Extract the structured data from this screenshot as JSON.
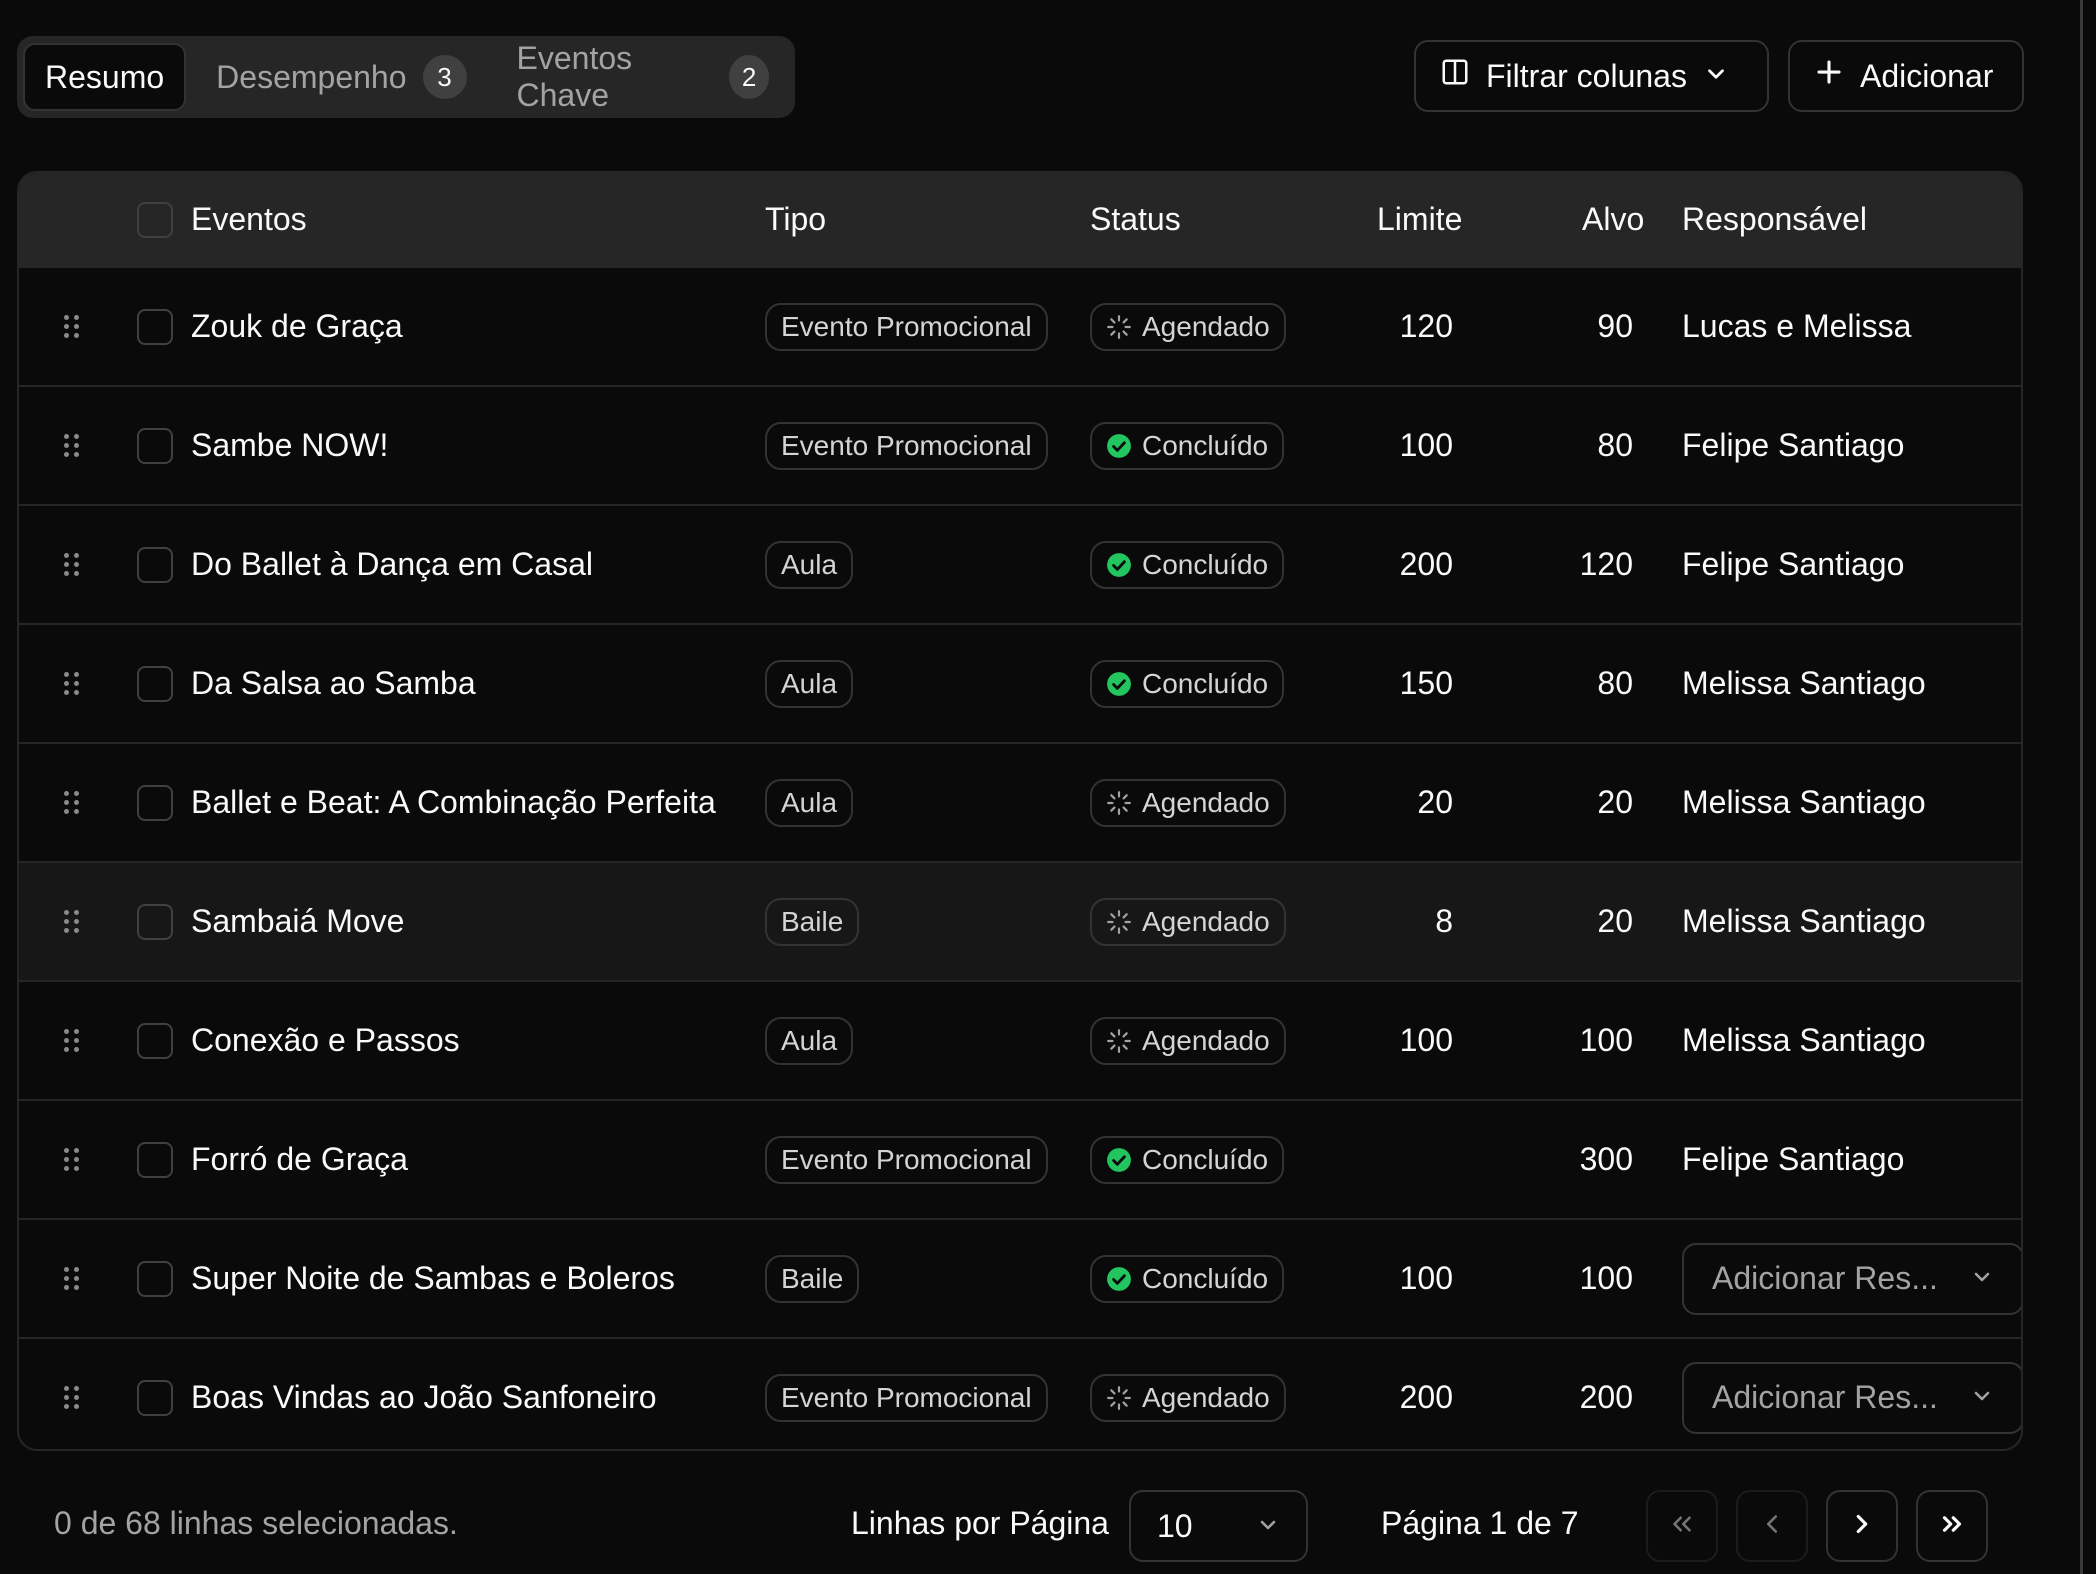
{
  "tabs": [
    {
      "label": "Resumo",
      "badge": null,
      "active": true
    },
    {
      "label": "Desempenho",
      "badge": "3",
      "active": false
    },
    {
      "label": "Eventos Chave",
      "badge": "2",
      "active": false
    }
  ],
  "toolbar": {
    "filter_label": "Filtrar colunas",
    "add_label": "Adicionar"
  },
  "table": {
    "headers": {
      "name": "Eventos",
      "type": "Tipo",
      "status": "Status",
      "limit": "Limite",
      "target": "Alvo",
      "owner": "Responsável"
    },
    "rows": [
      {
        "name": "Zouk de Graça",
        "type": "Evento Promocional",
        "status": "Agendado",
        "limit": "120",
        "target": "90",
        "owner": "Lucas e Melissa"
      },
      {
        "name": "Sambe NOW!",
        "type": "Evento Promocional",
        "status": "Concluído",
        "limit": "100",
        "target": "80",
        "owner": "Felipe Santiago"
      },
      {
        "name": "Do Ballet à Dança em Casal",
        "type": "Aula",
        "status": "Concluído",
        "limit": "200",
        "target": "120",
        "owner": "Felipe Santiago"
      },
      {
        "name": "Da Salsa ao Samba",
        "type": "Aula",
        "status": "Concluído",
        "limit": "150",
        "target": "80",
        "owner": "Melissa Santiago"
      },
      {
        "name": "Ballet e Beat: A Combinação Perfeita",
        "type": "Aula",
        "status": "Agendado",
        "limit": "20",
        "target": "20",
        "owner": "Melissa Santiago"
      },
      {
        "name": "Sambaiá Move",
        "type": "Baile",
        "status": "Agendado",
        "limit": "8",
        "target": "20",
        "owner": "Melissa Santiago"
      },
      {
        "name": "Conexão e Passos",
        "type": "Aula",
        "status": "Agendado",
        "limit": "100",
        "target": "100",
        "owner": "Melissa Santiago"
      },
      {
        "name": "Forró de Graça",
        "type": "Evento Promocional",
        "status": "Concluído",
        "limit": "",
        "target": "300",
        "owner": "Felipe Santiago"
      },
      {
        "name": "Super Noite de Sambas e Boleros",
        "type": "Baile",
        "status": "Concluído",
        "limit": "100",
        "target": "100",
        "owner": ""
      },
      {
        "name": "Boas Vindas ao João Sanfoneiro",
        "type": "Evento Promocional",
        "status": "Agendado",
        "limit": "200",
        "target": "200",
        "owner": ""
      }
    ],
    "owner_placeholder": "Adicionar Res..."
  },
  "footer": {
    "selection_text": "0 de 68 linhas selecionadas.",
    "rows_per_page_label": "Linhas por Página",
    "rows_per_page_value": "10",
    "page_text": "Página 1 de 7"
  },
  "colors": {
    "background": "#0a0a0a",
    "header_bg": "#262626",
    "border": "#262626",
    "success": "#22c55e",
    "muted_text": "#a3a3a3"
  },
  "icons": {
    "drag": "grip-vertical-icon",
    "scheduled": "loader-icon",
    "completed": "check-circle-icon",
    "columns": "columns-icon",
    "add": "plus-icon",
    "dropdown": "chevron-down-icon"
  }
}
